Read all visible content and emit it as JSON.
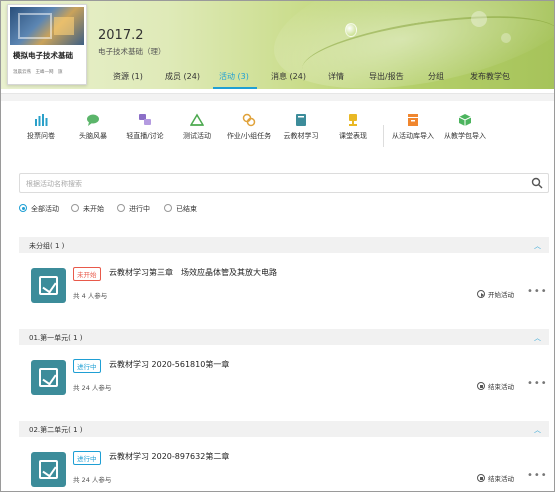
{
  "course_card": {
    "title": "模拟电子技术基础",
    "subtitle": "温晨云燕　王峰一网　旗"
  },
  "class_info": {
    "year": "2017.2",
    "name": "电子技术基础（理）"
  },
  "tabs": [
    {
      "label": "资源 (1)",
      "active": false
    },
    {
      "label": "成员 (24)",
      "active": false
    },
    {
      "label": "活动 (3)",
      "active": true
    },
    {
      "label": "消息 (24)",
      "active": false
    },
    {
      "label": "详情",
      "active": false
    },
    {
      "label": "导出/报告",
      "active": false
    },
    {
      "label": "分组",
      "active": false
    },
    {
      "label": "发布教学包",
      "active": false
    }
  ],
  "toolbar": [
    {
      "label": "投票问卷",
      "icon": "bar-chart-icon",
      "color": "#2aa0c9"
    },
    {
      "label": "头脑风暴",
      "icon": "chat-bubble-icon",
      "color": "#5bb56a"
    },
    {
      "label": "轻直播/讨论",
      "icon": "discussion-icon",
      "color": "#8b6ec7"
    },
    {
      "label": "测试活动",
      "icon": "test-icon",
      "color": "#4ca94f"
    },
    {
      "label": "作业/小组任务",
      "icon": "task-icon",
      "color": "#e0a23a"
    },
    {
      "label": "云教材学习",
      "icon": "book-icon",
      "color": "#3c8c9a"
    },
    {
      "label": "课堂表现",
      "icon": "trophy-icon",
      "color": "#e9b824"
    },
    {
      "label": "从活动库导入",
      "icon": "import-library-icon",
      "color": "#f0862e"
    },
    {
      "label": "从教学包导入",
      "icon": "import-package-icon",
      "color": "#4cb45e"
    }
  ],
  "search": {
    "placeholder": "根据活动名称搜索"
  },
  "filters": [
    {
      "label": "全部活动",
      "checked": true
    },
    {
      "label": "未开始",
      "checked": false
    },
    {
      "label": "进行中",
      "checked": false
    },
    {
      "label": "已结束",
      "checked": false
    }
  ],
  "groups": [
    {
      "title": "未分组( 1 )",
      "activity": {
        "status": "未开始",
        "status_kind": "notstart",
        "title": "云教材学习第三章　场效应晶体管及其放大电路",
        "participants": "共 4 人参与",
        "action": "开始活动"
      }
    },
    {
      "title": "01.第一单元( 1 )",
      "activity": {
        "status": "进行中",
        "status_kind": "running",
        "title": "云教材学习 2020-561810第一章",
        "participants": "共 24 人参与",
        "action": "结束活动"
      }
    },
    {
      "title": "02.第二单元( 1 )",
      "activity": {
        "status": "进行中",
        "status_kind": "running",
        "title": "云教材学习 2020-897632第二章",
        "participants": "共 24 人参与",
        "action": "结束活动"
      }
    }
  ]
}
